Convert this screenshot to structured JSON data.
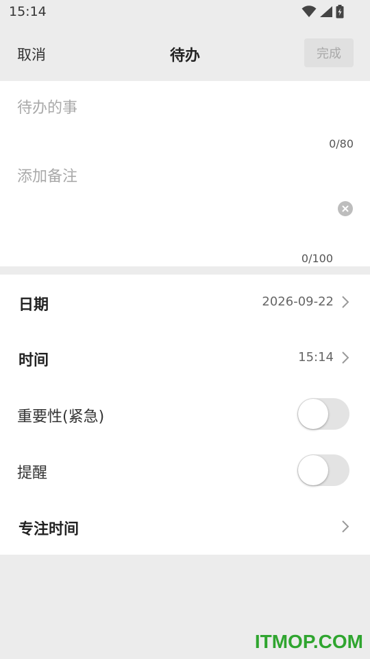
{
  "status_bar": {
    "time": "15:14",
    "icons": [
      "wifi-icon",
      "cellular-signal-icon",
      "battery-charging-icon"
    ]
  },
  "header": {
    "cancel_label": "取消",
    "title": "待办",
    "done_label": "完成"
  },
  "form": {
    "todo_value": "",
    "todo_placeholder": "待办的事",
    "todo_count": "0/80",
    "note_value": "",
    "note_placeholder": "添加备注",
    "note_count": "0/100"
  },
  "settings": {
    "date": {
      "label": "日期",
      "value": "2026-09-22"
    },
    "time": {
      "label": "时间",
      "value": "15:14"
    },
    "importance": {
      "label": "重要性(紧急)",
      "enabled": false
    },
    "reminder": {
      "label": "提醒",
      "enabled": false
    },
    "focus_time": {
      "label": "专注时间"
    }
  },
  "watermark": "ITMOP.COM",
  "colors": {
    "background": "#ececec",
    "card": "#ffffff",
    "placeholder": "#a9a9a9",
    "toggle_off": "#e3e3e3",
    "watermark": "#2fa52f"
  }
}
